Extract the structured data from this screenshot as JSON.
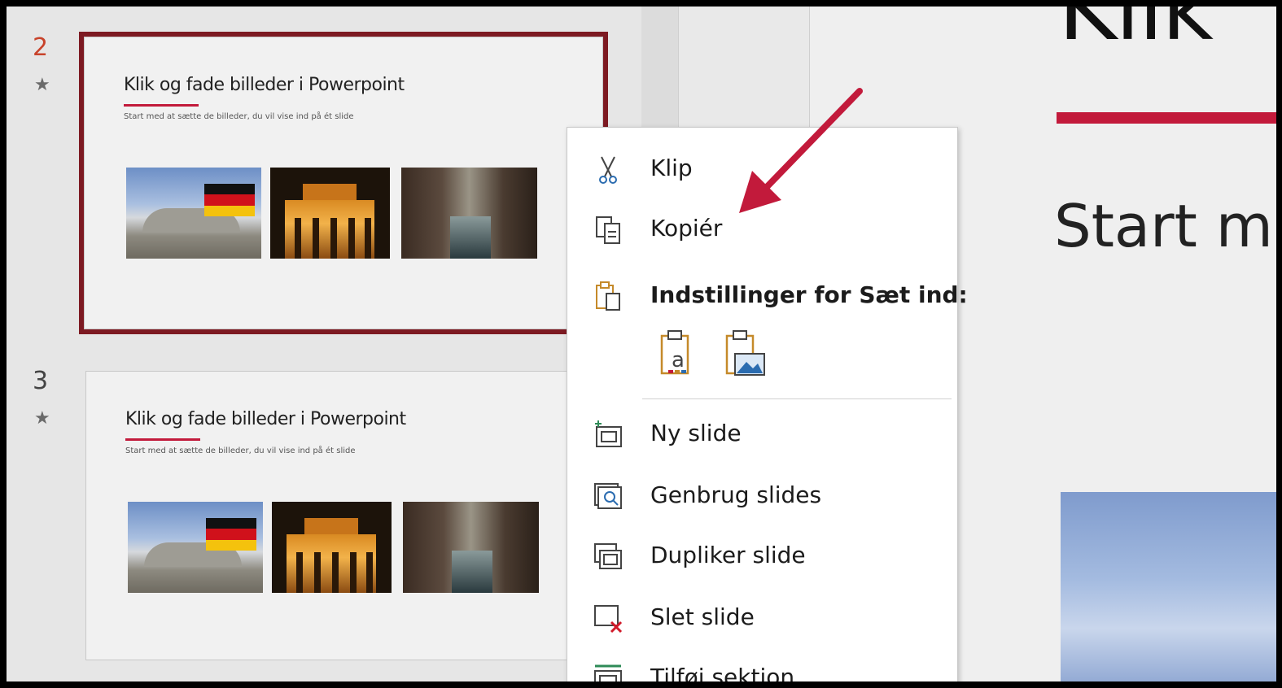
{
  "thumbnails": [
    {
      "number": "2",
      "star": "★",
      "selected": true,
      "title": "Klik og fade billeder i Powerpoint",
      "subtitle": "Start med at sætte de billeder, du vil vise ind på ét slide"
    },
    {
      "number": "3",
      "star": "★",
      "selected": false,
      "title": "Klik og fade billeder i Powerpoint",
      "subtitle": "Start med at sætte de billeder, du vil vise ind på ét slide"
    }
  ],
  "main_slide": {
    "title_fragment": "Klik",
    "subtitle_fragment": "Start m"
  },
  "context_menu": {
    "items": [
      {
        "label": "Klip",
        "icon": "scissors-icon"
      },
      {
        "label": "Kopiér",
        "icon": "copy-icon"
      },
      {
        "label": "Indstillinger for Sæt ind:",
        "icon": "paste-icon",
        "bold": true
      },
      {
        "label": "Ny slide",
        "icon": "new-slide-icon"
      },
      {
        "label": "Genbrug slides",
        "icon": "reuse-slides-icon"
      },
      {
        "label": "Dupliker slide",
        "icon": "duplicate-slide-icon"
      },
      {
        "label": "Slet slide",
        "icon": "delete-slide-icon"
      },
      {
        "label": "Tilføj sektion",
        "icon": "add-section-icon"
      }
    ],
    "paste_options": [
      {
        "icon": "paste-keep-text-icon"
      },
      {
        "icon": "paste-picture-icon"
      }
    ]
  },
  "colors": {
    "accent_red": "#c21a3b",
    "selection_border": "#7d1a22",
    "slide_number_selected": "#c8432b",
    "slide_number": "#444444"
  }
}
